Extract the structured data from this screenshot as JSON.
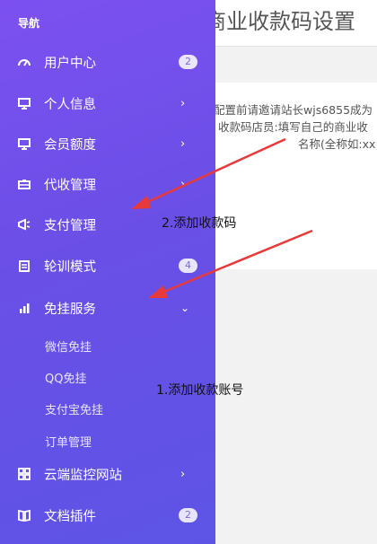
{
  "page": {
    "title": "商业收款码设置"
  },
  "panel": {
    "line1": "配置前请邀请站长wjs6855成为",
    "line2": "收款码店员:填写自己的商业收",
    "line3": "名称(全称如:xx"
  },
  "sidebar": {
    "title": "导航",
    "items": [
      {
        "label": "用户中心",
        "icon": "gauge-icon",
        "badge": "2"
      },
      {
        "label": "个人信息",
        "icon": "monitor-icon"
      },
      {
        "label": "会员额度",
        "icon": "monitor-icon"
      },
      {
        "label": "代收管理",
        "icon": "briefcase-icon"
      },
      {
        "label": "支付管理",
        "icon": "megaphone-icon"
      },
      {
        "label": "轮训模式",
        "icon": "calendar-icon",
        "badge": "4"
      },
      {
        "label": "免挂服务",
        "icon": "bar-chart-icon"
      },
      {
        "label": "云端监控网站",
        "icon": "grid-icon"
      },
      {
        "label": "文档插件",
        "icon": "book-icon",
        "badge": "2"
      }
    ],
    "subitems": [
      "微信免挂",
      "QQ免挂",
      "支付宝免挂",
      "订单管理"
    ]
  },
  "annotations": {
    "step2": "2.添加收款码",
    "step1": "1.添加收款账号",
    "arrow_color": "#e83a3a"
  }
}
